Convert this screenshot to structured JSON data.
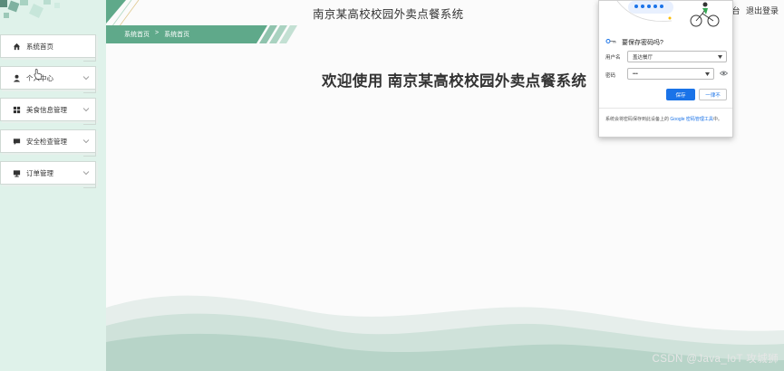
{
  "app": {
    "title": "南京某高校校园外卖点餐系统",
    "top_links": [
      "台",
      "退出登录"
    ]
  },
  "breadcrumb": {
    "home": "系统首页",
    "separator": ">",
    "current": "系统首页"
  },
  "welcome": "欢迎使用 南京某高校校园外卖点餐系统",
  "sidebar": {
    "items": [
      {
        "label": "系统首页",
        "icon": "home-icon",
        "expandable": false
      },
      {
        "label": "个人中心",
        "icon": "user-icon",
        "expandable": true
      },
      {
        "label": "美食信息管理",
        "icon": "grid-icon",
        "expandable": true
      },
      {
        "label": "安全检查管理",
        "icon": "chat-icon",
        "expandable": true
      },
      {
        "label": "订单管理",
        "icon": "monitor-icon",
        "expandable": true
      }
    ]
  },
  "password_popup": {
    "title": "要保存密码吗?",
    "username_label": "用户名",
    "username_value": "盖达餐厅",
    "password_label": "密码",
    "password_value": "•••",
    "save_label": "保存",
    "never_label": "一律不",
    "footer_prefix": "系统会将密码保存到此设备上的 ",
    "footer_link": "Google 密码管理工具",
    "footer_suffix": "中。"
  },
  "watermark": "CSDN @Java_IoT 攻城狮",
  "colors": {
    "sidebar_bg": "#dff2ea",
    "accent_green": "#5fa98a",
    "primary_blue": "#1a73e8"
  }
}
